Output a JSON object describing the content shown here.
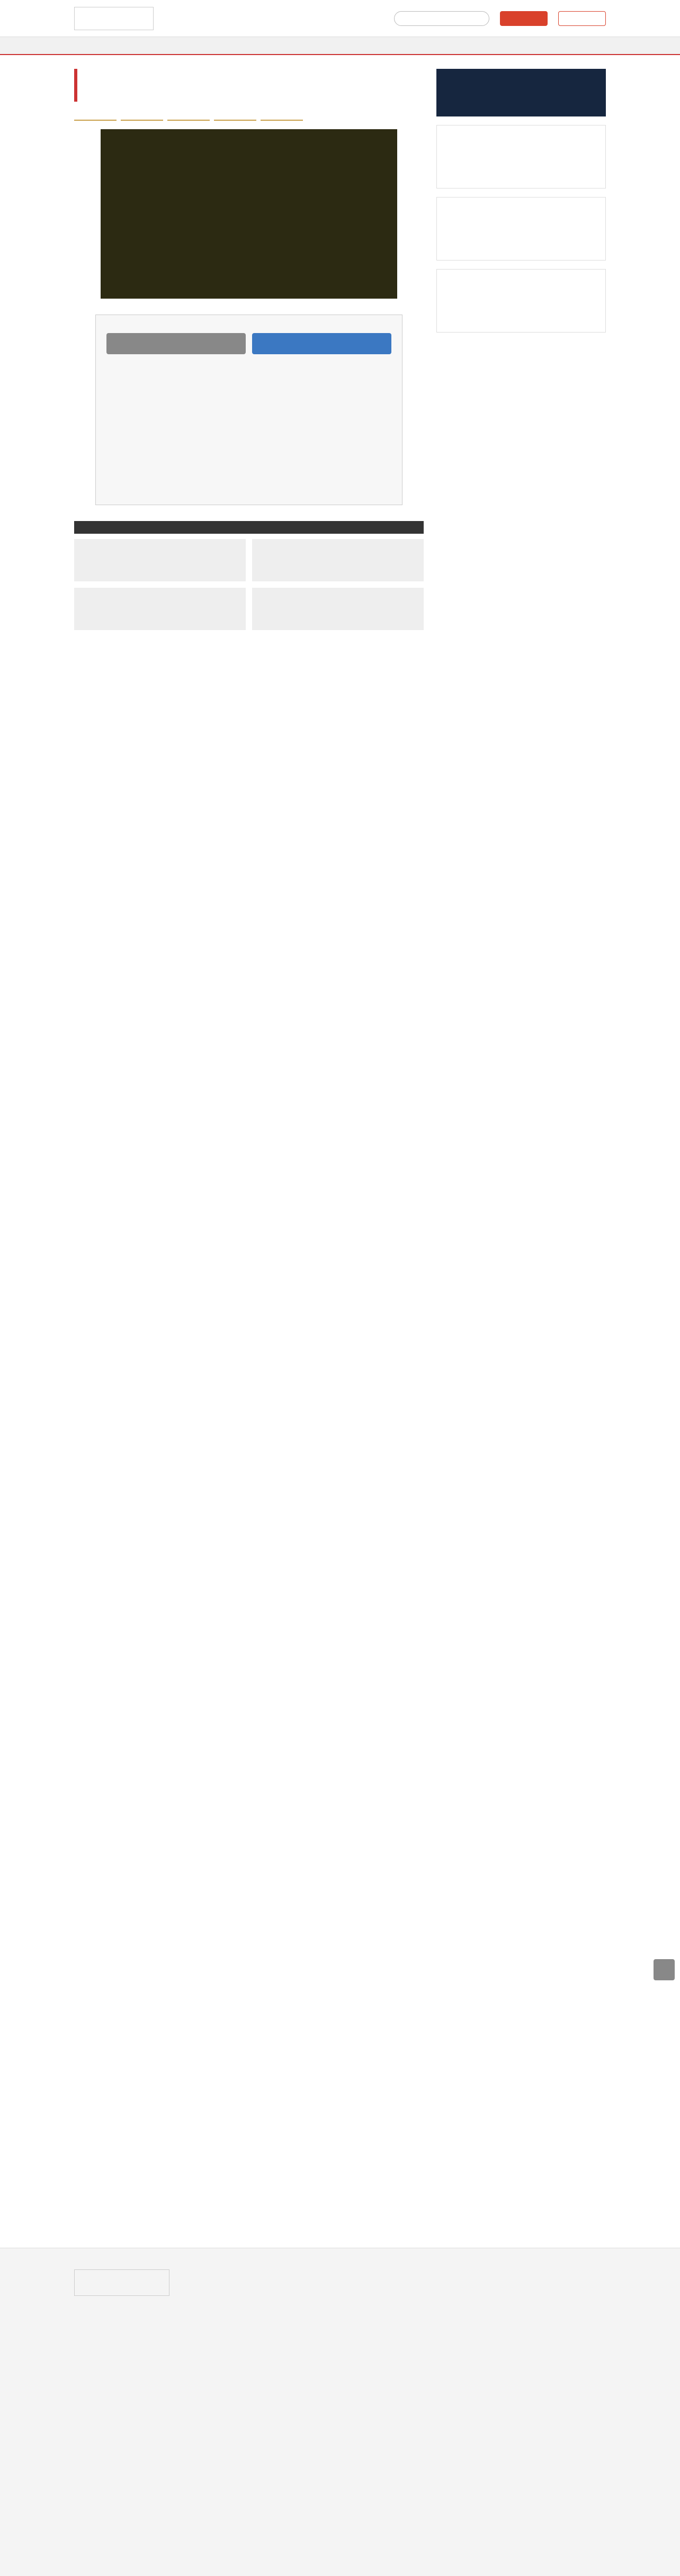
{
  "header": {
    "logo_text": "",
    "date_text": "",
    "search_placeholder": "",
    "register_label": "",
    "login_label": ""
  },
  "nav": {
    "items": []
  },
  "breadcrumb": {
    "items": []
  },
  "article": {
    "title": "",
    "subtitle": "",
    "author": "",
    "date": "",
    "paragraphs": []
  },
  "paywall": {
    "message": "",
    "login_label": "",
    "register_label": ""
  },
  "sections": [],
  "sidebar": {
    "ranking_title": "",
    "ranking_items": []
  },
  "footer": {
    "links": [],
    "copyright": ""
  }
}
